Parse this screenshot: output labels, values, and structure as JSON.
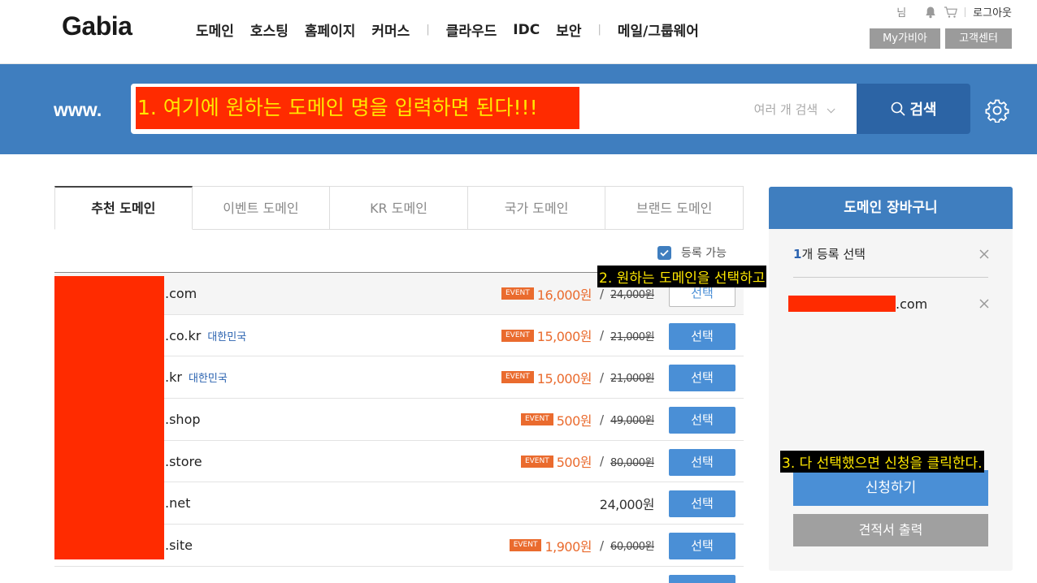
{
  "header": {
    "logo": "Gabia",
    "nav": [
      "도메인",
      "호스팅",
      "홈페이지",
      "커머스",
      "클라우드",
      "IDC",
      "보안",
      "메일/그룹웨어"
    ],
    "user_suffix": "님",
    "logout": "로그아웃",
    "my_button": "My가비아",
    "cs_button": "고객센터"
  },
  "search": {
    "prefix": "www.",
    "input_value": "1. 여기에 원하는 도메인 명을 입력하면 된다!!!",
    "multi_label": "여러 개 검색",
    "button_label": "검색"
  },
  "tabs": [
    {
      "label": "추천 도메인",
      "active": true
    },
    {
      "label": "이벤트 도메인",
      "active": false
    },
    {
      "label": "KR 도메인",
      "active": false
    },
    {
      "label": "국가 도메인",
      "active": false
    },
    {
      "label": "브랜드 도메인",
      "active": false
    }
  ],
  "filter": {
    "label": "등록 가능",
    "checked": true
  },
  "event_badge": "EVENT",
  "rows": [
    {
      "tld": ".com",
      "country": "",
      "sale": "16,000원",
      "orig": "24,000원",
      "button": "선택",
      "selected": true
    },
    {
      "tld": ".co.kr",
      "country": "대한민국",
      "sale": "15,000원",
      "orig": "21,000원",
      "button": "선택",
      "selected": false
    },
    {
      "tld": ".kr",
      "country": "대한민국",
      "sale": "15,000원",
      "orig": "21,000원",
      "button": "선택",
      "selected": false
    },
    {
      "tld": ".shop",
      "country": "",
      "sale": "500원",
      "orig": "49,000원",
      "button": "선택",
      "selected": false
    },
    {
      "tld": ".store",
      "country": "",
      "sale": "500원",
      "orig": "80,000원",
      "button": "선택",
      "selected": false
    },
    {
      "tld": ".net",
      "country": "",
      "price": "24,000원",
      "button": "선택",
      "selected": false
    },
    {
      "tld": ".site",
      "country": "",
      "sale": "1,900원",
      "orig": "60,000원",
      "button": "선택",
      "selected": false
    }
  ],
  "annotations": {
    "step2": "2. 원하는 도메인을 선택하고",
    "step3": "3. 다 선택했으면 신청을 클릭한다."
  },
  "cart": {
    "title": "도메인 장바구니",
    "count": "1",
    "count_suffix": "개 등록 선택",
    "item_tld": ".com",
    "apply_button": "신청하기",
    "quote_button": "견적서 출력"
  },
  "colors": {
    "brand_blue": "#3f7ebf",
    "event_orange": "#ea6b2e",
    "redaction": "#ff2b00",
    "annotation_text": "#ffe800"
  }
}
